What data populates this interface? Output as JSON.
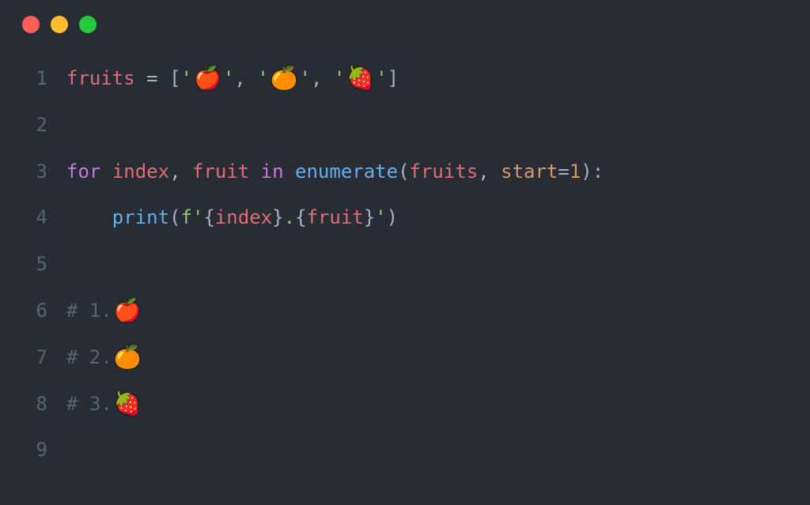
{
  "window": {
    "traffic_lights": [
      "red",
      "yellow",
      "green"
    ]
  },
  "code": {
    "lines": [
      {
        "num": "1"
      },
      {
        "num": "2"
      },
      {
        "num": "3"
      },
      {
        "num": "4"
      },
      {
        "num": "5"
      },
      {
        "num": "6"
      },
      {
        "num": "7"
      },
      {
        "num": "8"
      },
      {
        "num": "9"
      }
    ],
    "line1": {
      "var": "fruits",
      "eq": " = ",
      "lb": "[",
      "q1": "'",
      "apple": "🍎",
      "q2": "'",
      "c1": ", ",
      "q3": "'",
      "orange": "🍊",
      "q4": "'",
      "c2": ", ",
      "q5": "'",
      "strawberry": "🍓",
      "q6": "'",
      "rb": "]"
    },
    "line3": {
      "for": "for",
      "sp1": " ",
      "index": "index",
      "comma": ", ",
      "fruit": "fruit",
      "sp2": " ",
      "in": "in",
      "sp3": " ",
      "enum": "enumerate",
      "lp": "(",
      "fruits": "fruits",
      "comma2": ", ",
      "start": "start",
      "eq": "=",
      "one": "1",
      "rp": ")",
      "colon": ":"
    },
    "line4": {
      "indent": "    ",
      "print": "print",
      "lp": "(",
      "f": "f",
      "q1": "'",
      "lb1": "{",
      "index": "index",
      "rb1": "}",
      "dot": ".",
      "lb2": "{",
      "fruit": "fruit",
      "rb2": "}",
      "q2": "'",
      "rp": ")"
    },
    "line6": {
      "hash": "# ",
      "num": "1.",
      "emoji": "🍎"
    },
    "line7": {
      "hash": "# ",
      "num": "2.",
      "emoji": "🍊"
    },
    "line8": {
      "hash": "# ",
      "num": "3.",
      "emoji": "🍓"
    }
  }
}
